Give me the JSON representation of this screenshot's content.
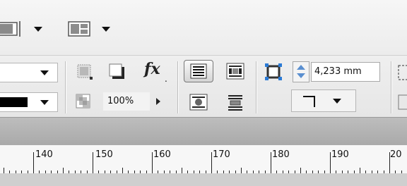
{
  "topbar": {
    "icons": [
      "screen-mode-icon",
      "arrange-documents-icon"
    ]
  },
  "control_panel": {
    "opacity_value": "100%",
    "stroke_weight": "4,233 mm",
    "fx_label": "fx"
  },
  "ruler": {
    "labels": [
      "140",
      "150",
      "160",
      "170",
      "180",
      "190",
      "20"
    ]
  }
}
